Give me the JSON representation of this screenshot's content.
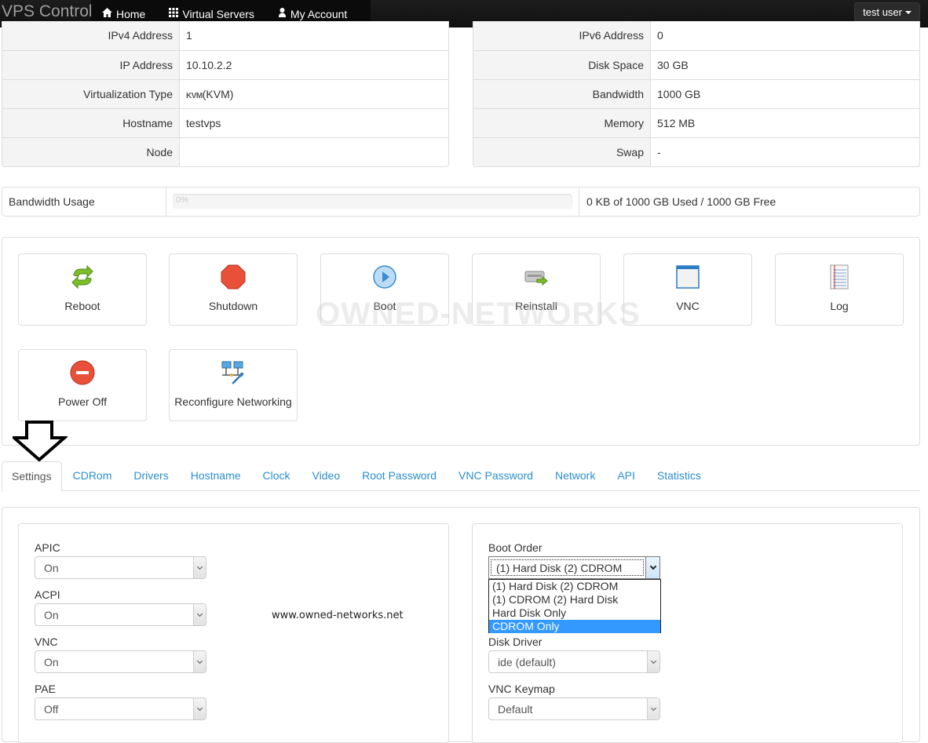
{
  "navbar": {
    "brand": "VPS Control",
    "items": [
      {
        "label": "Home",
        "icon": "home-icon"
      },
      {
        "label": "Virtual Servers",
        "icon": "grid-icon"
      },
      {
        "label": "My Account",
        "icon": "user-icon"
      }
    ],
    "user_menu": "test user"
  },
  "info_left": [
    {
      "label": "IPv4 Address",
      "value": "1"
    },
    {
      "label": "IP Address",
      "value": "10.10.2.2"
    },
    {
      "label": "Virtualization Type",
      "value": "(KVM)",
      "badge": "KVM"
    },
    {
      "label": "Hostname",
      "value": "testvps"
    },
    {
      "label": "Node",
      "value": ""
    }
  ],
  "info_right": [
    {
      "label": "IPv6 Address",
      "value": "0"
    },
    {
      "label": "Disk Space",
      "value": "30 GB"
    },
    {
      "label": "Bandwidth",
      "value": "1000 GB"
    },
    {
      "label": "Memory",
      "value": "512 MB"
    },
    {
      "label": "Swap",
      "value": "-"
    }
  ],
  "bandwidth": {
    "label": "Bandwidth Usage",
    "percent_label": "0%",
    "percent": 0,
    "summary": "0 KB of 1000 GB Used / 1000 GB Free"
  },
  "actions": [
    {
      "label": "Reboot",
      "icon": "reboot-icon"
    },
    {
      "label": "Shutdown",
      "icon": "shutdown-icon"
    },
    {
      "label": "Boot",
      "icon": "boot-icon"
    },
    {
      "label": "Reinstall",
      "icon": "reinstall-icon"
    },
    {
      "label": "VNC",
      "icon": "vnc-icon"
    },
    {
      "label": "Log",
      "icon": "log-icon"
    },
    {
      "label": "Power Off",
      "icon": "power-off-icon"
    },
    {
      "label": "Reconfigure Networking",
      "icon": "network-icon"
    }
  ],
  "watermark": "OWNED-NETWORKS",
  "tabs": [
    {
      "label": "Settings",
      "active": true
    },
    {
      "label": "CDRom"
    },
    {
      "label": "Drivers"
    },
    {
      "label": "Hostname"
    },
    {
      "label": "Clock"
    },
    {
      "label": "Video"
    },
    {
      "label": "Root Password"
    },
    {
      "label": "VNC Password"
    },
    {
      "label": "Network"
    },
    {
      "label": "API"
    },
    {
      "label": "Statistics"
    }
  ],
  "settings_left": [
    {
      "label": "APIC",
      "value": "On"
    },
    {
      "label": "ACPI",
      "value": "On"
    },
    {
      "label": "VNC",
      "value": "On"
    },
    {
      "label": "PAE",
      "value": "Off"
    }
  ],
  "website": "www.owned-networks.net",
  "settings_right": {
    "boot_order": {
      "label": "Boot Order",
      "value": "(1) Hard Disk (2) CDROM",
      "options": [
        "(1) Hard Disk (2) CDROM",
        "(1) CDROM (2) Hard Disk",
        "Hard Disk Only",
        "CDROM Only"
      ],
      "highlighted": "CDROM Only"
    },
    "disk_driver": {
      "label": "Disk Driver",
      "value": "ide (default)"
    },
    "vnc_keymap": {
      "label": "VNC Keymap",
      "value": "Default"
    }
  }
}
